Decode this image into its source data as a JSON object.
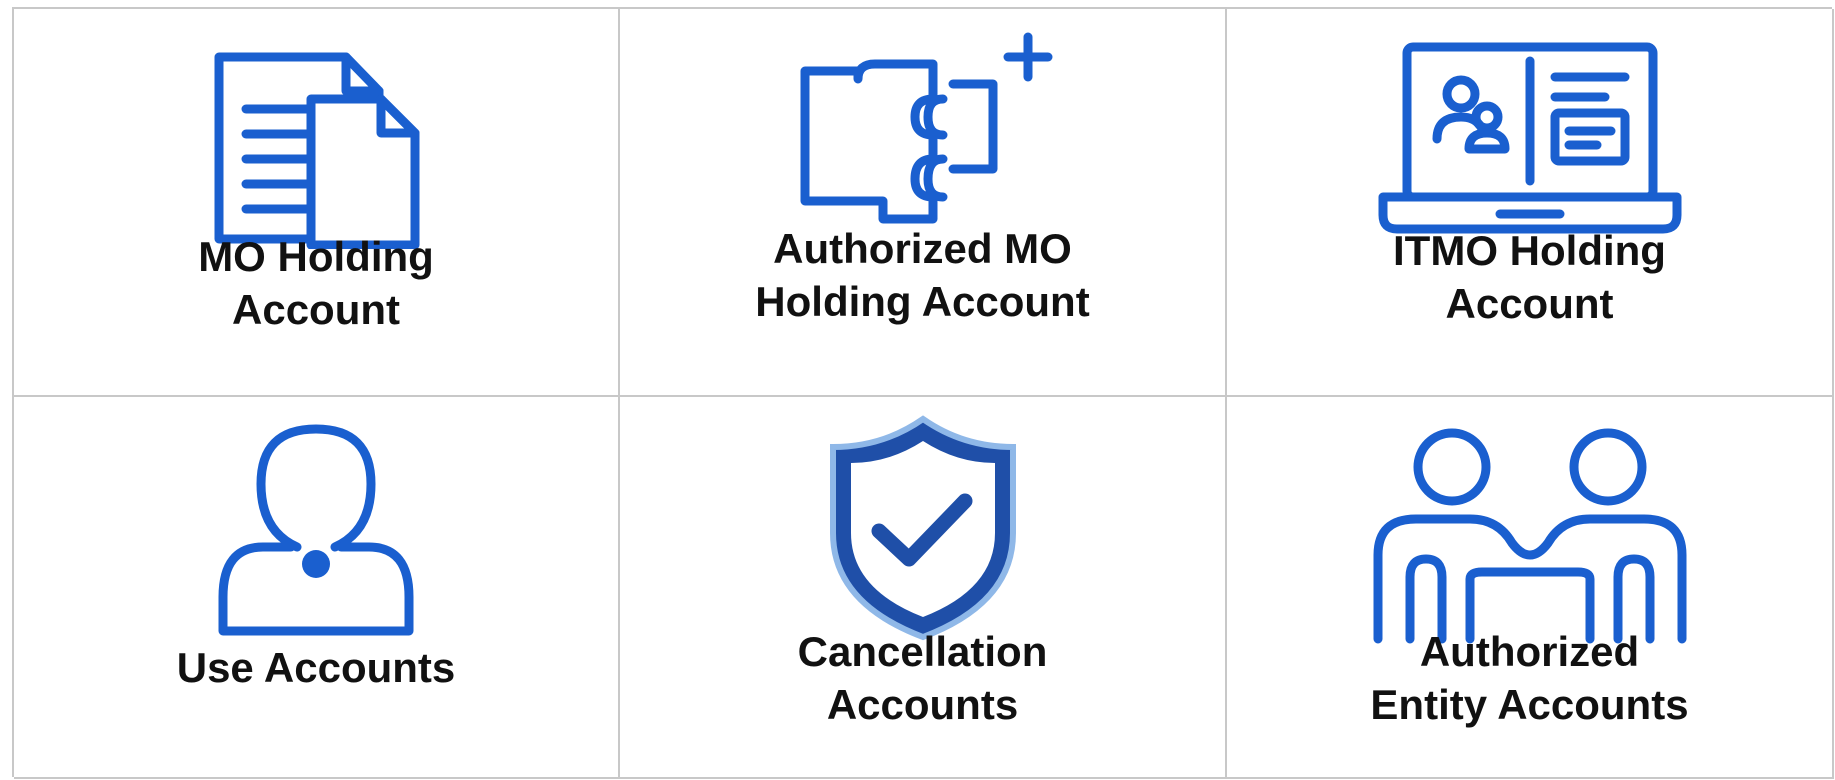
{
  "accent_color": "#1a5fcf",
  "cards": [
    {
      "id": "mo-holding",
      "icon": "documents-icon",
      "lines": [
        "MO Holding",
        "Account"
      ]
    },
    {
      "id": "authorized-mo-holding",
      "icon": "puzzle-plus-icon",
      "lines": [
        "Authorized MO",
        "Holding Account"
      ]
    },
    {
      "id": "itmo-holding",
      "icon": "laptop-profile-icon",
      "lines": [
        "ITMO Holding",
        "Account"
      ]
    },
    {
      "id": "use",
      "icon": "user-icon",
      "lines": [
        "Use Accounts"
      ]
    },
    {
      "id": "cancellation",
      "icon": "shield-check-icon",
      "lines": [
        "Cancellation",
        "Accounts"
      ]
    },
    {
      "id": "authorized-entity",
      "icon": "two-people-icon",
      "lines": [
        "Authorized",
        "Entity Accounts"
      ]
    }
  ]
}
